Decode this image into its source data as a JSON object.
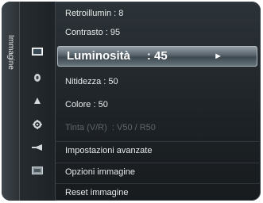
{
  "sidebar": {
    "label": "Immagine"
  },
  "icons": [
    {
      "name": "picture-icon",
      "active": true
    },
    {
      "name": "sound-icon",
      "active": false
    },
    {
      "name": "channel-icon",
      "active": false
    },
    {
      "name": "setup-icon",
      "active": false
    },
    {
      "name": "input-icon",
      "active": false
    },
    {
      "name": "application-icon",
      "active": false
    }
  ],
  "menu": {
    "items": [
      {
        "label": "Retroillumin : 8"
      },
      {
        "label": "Contrasto : 95"
      },
      {
        "label": "Luminosità     : 45",
        "arrow": "►"
      },
      {
        "label": "Nitidezza : 50"
      },
      {
        "label": "Colore : 50"
      },
      {
        "label": "Tinta (V/R)  : V50 / R50"
      },
      {
        "label": "Impostazioni avanzate"
      },
      {
        "label": "Opzioni immagine"
      },
      {
        "label": "Reset immagine"
      }
    ]
  }
}
